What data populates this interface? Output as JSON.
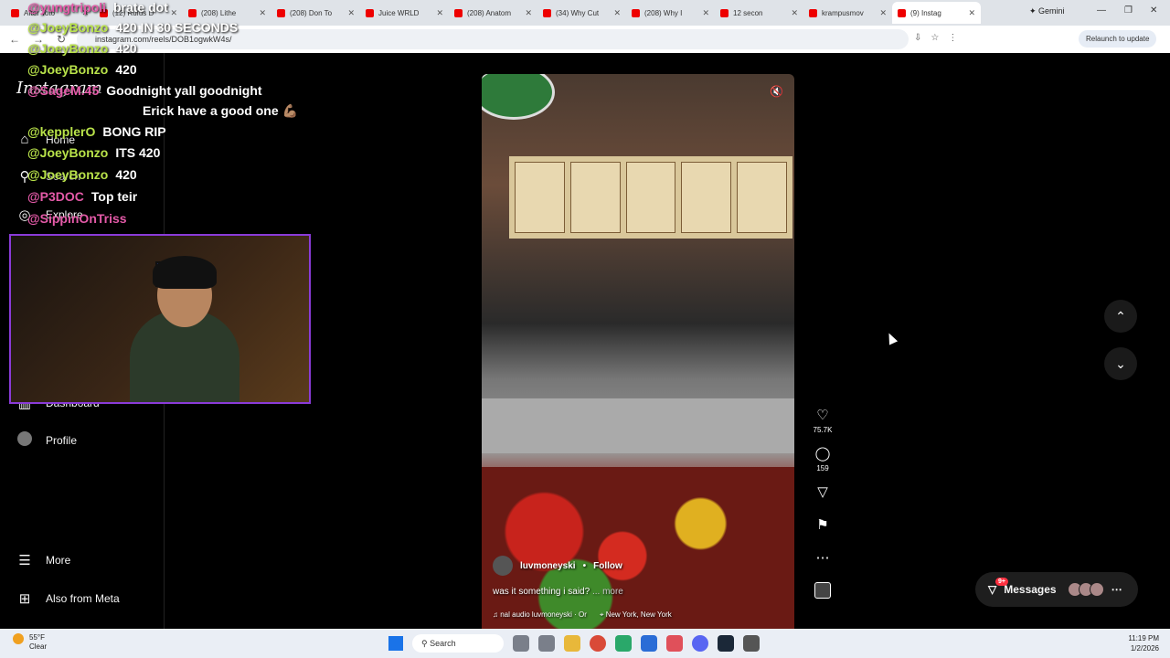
{
  "browser": {
    "tabs": [
      {
        "label": "After Toto",
        "active": false
      },
      {
        "label": "(12) Rufus D",
        "active": false
      },
      {
        "label": "(208) Lithe",
        "active": false
      },
      {
        "label": "(208) Don To",
        "active": false
      },
      {
        "label": "Juice WRLD",
        "active": false
      },
      {
        "label": "(208) Anatom",
        "active": false
      },
      {
        "label": "(34) Why Cut",
        "active": false
      },
      {
        "label": "(208) Why I",
        "active": false
      },
      {
        "label": "12 secon",
        "active": false
      },
      {
        "label": "krampusmov",
        "active": false
      },
      {
        "label": "(9) Instag",
        "active": true
      }
    ],
    "gemini_label": "Gemini",
    "url": "instagram.com/reels/DOB1ogwkW4s/",
    "relaunch_label": "Relaunch to update"
  },
  "sidebar": {
    "logo": "Instagram",
    "items": [
      {
        "label": "Home",
        "icon": "home-icon"
      },
      {
        "label": "Search",
        "icon": "search-icon"
      },
      {
        "label": "Explore",
        "icon": "explore-icon"
      },
      {
        "label": "Dashboard",
        "icon": "dashboard-icon"
      },
      {
        "label": "Profile",
        "icon": "avatar"
      },
      {
        "label": "More",
        "icon": "menu-icon"
      },
      {
        "label": "Also from Meta",
        "icon": "meta-icon"
      }
    ]
  },
  "chat": {
    "messages": [
      {
        "user": "@yungtripoli",
        "text": "brate dot",
        "color": "#e45aa8"
      },
      {
        "user": "@JoeyBonzo",
        "text": "420 IN 30 SECONDS",
        "color": "#b9e34a"
      },
      {
        "user": "@JoeyBonzo",
        "text": "420",
        "color": "#b9e34a"
      },
      {
        "user": "@JoeyBonzo",
        "text": "420",
        "color": "#b9e34a"
      },
      {
        "user": "@SageM.45",
        "text": "Goodnight yall goodnight",
        "color": "#e45aa8"
      },
      {
        "user": "",
        "text": "Erick have a good one 💪🏽",
        "color": "#ffffff"
      },
      {
        "user": "@kepplerO",
        "text": "BONG RIP",
        "color": "#b9e34a"
      },
      {
        "user": "@JoeyBonzo",
        "text": "ITS 420",
        "color": "#b9e34a"
      },
      {
        "user": "@JoeyBonzo",
        "text": "420",
        "color": "#b9e34a"
      },
      {
        "user": "@P3DOC",
        "text": "Top teir",
        "color": "#e45aa8"
      },
      {
        "user": "@SippinOnTriss",
        "text": "",
        "color": "#e45aa8"
      }
    ]
  },
  "reel": {
    "username": "luvmoneyski",
    "follow_label": "Follow",
    "caption": "was it something i said?",
    "more_label": "... more",
    "audio": "nal audio  luvmoneyski · Or",
    "location": "New York, New York",
    "likes": "75.7K",
    "comments": "159"
  },
  "messages": {
    "label": "Messages",
    "badge": "9+"
  },
  "taskbar": {
    "weather_temp": "55°F",
    "weather_text": "Clear",
    "search_label": "Search",
    "time": "11:19 PM",
    "date": "1/2/2026"
  }
}
